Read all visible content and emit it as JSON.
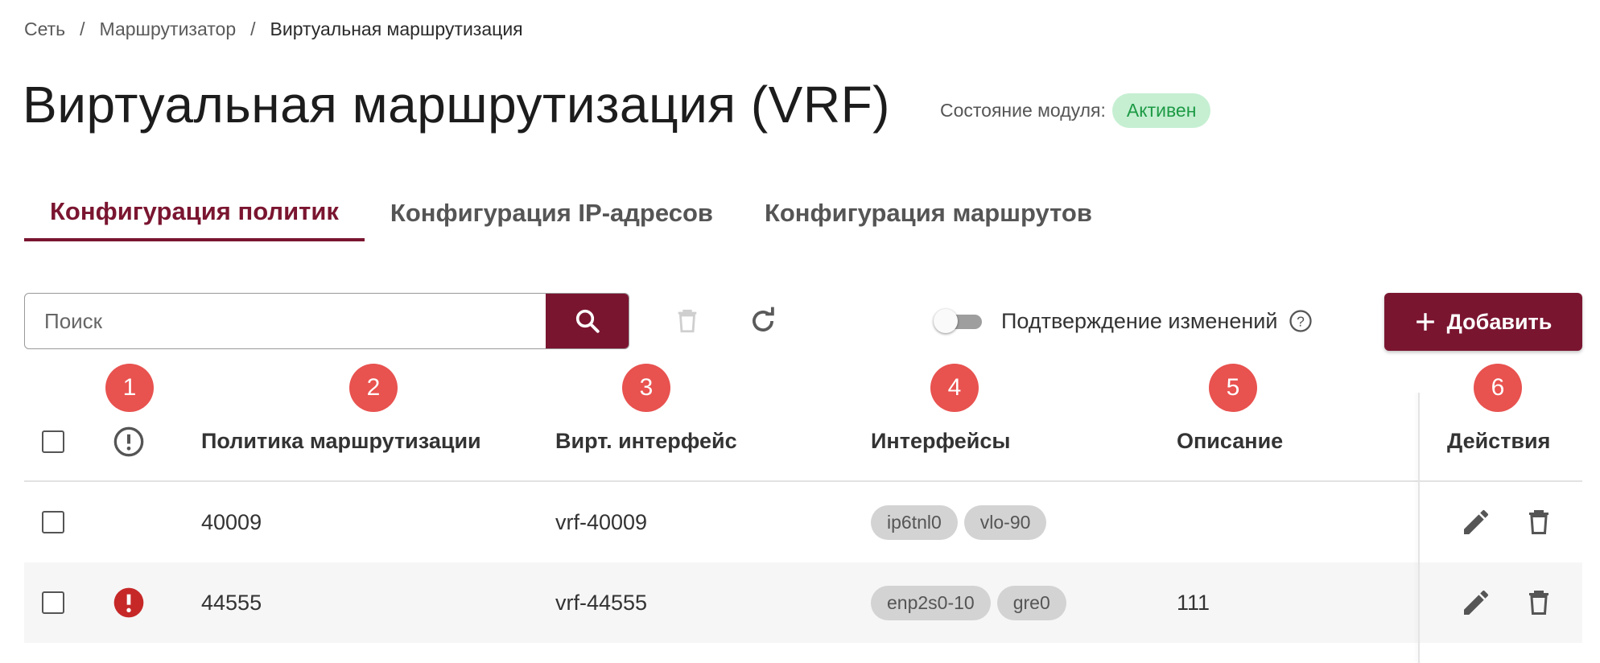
{
  "breadcrumb": [
    "Сеть",
    "Маршрутизатор",
    "Виртуальная маршрутизация"
  ],
  "page": {
    "title": "Виртуальная маршрутизация (VRF)",
    "status_label": "Состояние модуля:",
    "status_value": "Активен"
  },
  "tabs": [
    {
      "label": "Конфигурация политик",
      "active": true
    },
    {
      "label": "Конфигурация IP-адресов",
      "active": false
    },
    {
      "label": "Конфигурация маршрутов",
      "active": false
    }
  ],
  "toolbar": {
    "search_placeholder": "Поиск",
    "confirm_label": "Подтверждение изменений",
    "confirm_enabled": false,
    "add_label": "Добавить"
  },
  "markers": [
    "1",
    "2",
    "3",
    "4",
    "5",
    "6"
  ],
  "table": {
    "columns": [
      "Политика маршрутизации",
      "Вирт. интерфейс",
      "Интерфейсы",
      "Описание",
      "Действия"
    ],
    "rows": [
      {
        "policy": "40009",
        "vif": "vrf-40009",
        "interfaces": [
          "ip6tnl0",
          "vlo-90"
        ],
        "description": "",
        "error": false
      },
      {
        "policy": "44555",
        "vif": "vrf-44555",
        "interfaces": [
          "enp2s0-10",
          "gre0"
        ],
        "description": "111",
        "error": true
      }
    ]
  },
  "colors": {
    "accent": "#7a1530",
    "status_bg": "#c6efd2",
    "status_text": "#1d9a45",
    "marker": "#e8524f",
    "error": "#c62828"
  }
}
